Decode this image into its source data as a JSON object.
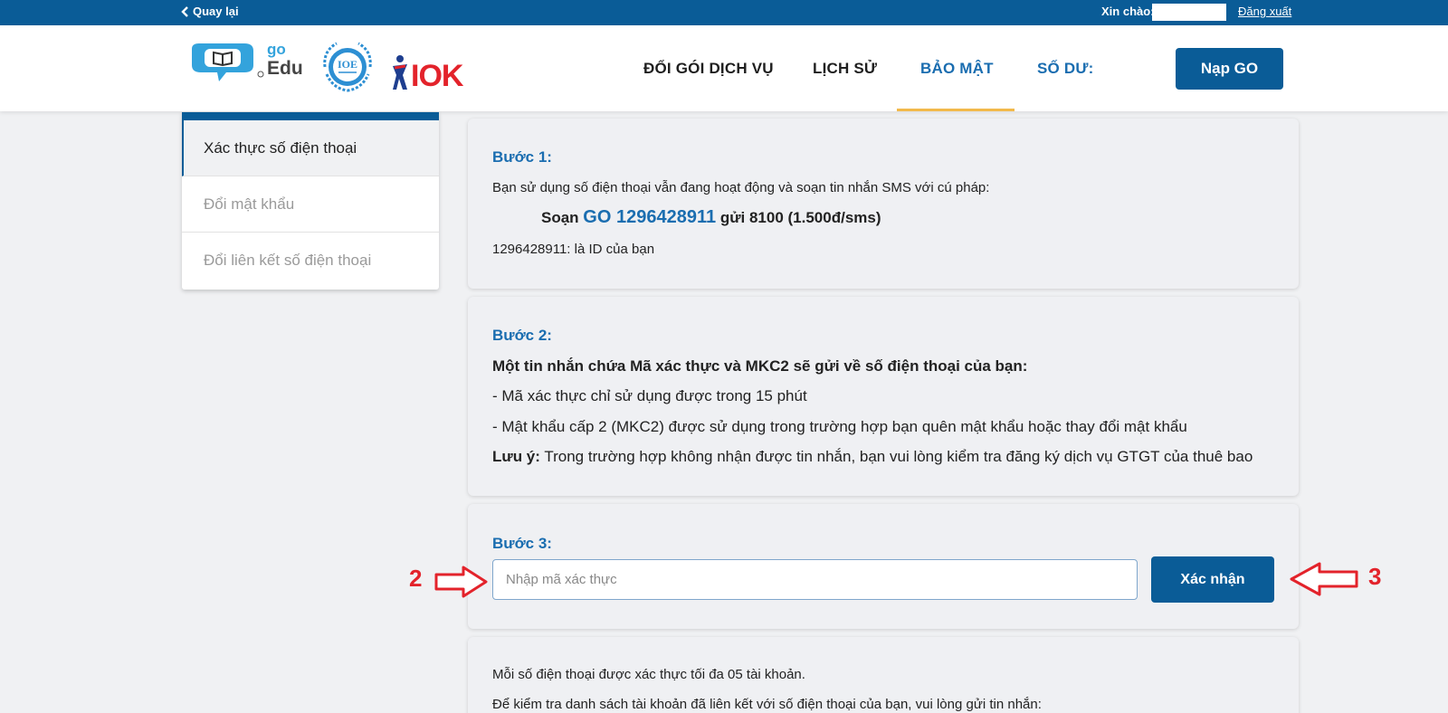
{
  "topbar": {
    "back_label": "Quay lại",
    "greeting_label": "Xin chào:",
    "username_value": "",
    "logout_label": "Đăng xuất"
  },
  "header": {
    "logos": {
      "goedu_top": "go",
      "goedu_bottom": "Edu",
      "ioe": "IOE",
      "iok": "IOK"
    },
    "nav": [
      {
        "label": "ĐỔI GÓI DỊCH VỤ",
        "active": false
      },
      {
        "label": "LỊCH SỬ",
        "active": false
      },
      {
        "label": "BẢO MẬT",
        "active": true
      },
      {
        "label": "SỐ DƯ:",
        "active": false
      }
    ],
    "topup_button": "Nạp GO"
  },
  "sidebar": {
    "items": [
      {
        "label": "Xác thực số điện thoại",
        "active": true
      },
      {
        "label": "Đổi mật khẩu",
        "active": false
      },
      {
        "label": "Đổi liên kết số điện thoại",
        "active": false
      }
    ]
  },
  "step1": {
    "title": "Bước 1:",
    "intro": "Bạn sử dụng số điện thoại vẫn đang hoạt động và soạn tin nhắn SMS với cú pháp:",
    "sms_prefix": "Soạn",
    "sms_code": "GO 1296428911",
    "sms_suffix": "gửi 8100 (1.500đ/sms)",
    "id_note": "1296428911: là ID của bạn"
  },
  "step2": {
    "title": "Bước 2:",
    "heading": "Một tin nhắn chứa Mã xác thực và MKC2 sẽ gửi về số điện thoại của bạn:",
    "line1": "- Mã xác thực chỉ sử dụng được trong 15 phút",
    "line2": "- Mật khẩu cấp 2 (MKC2) được sử dụng trong trường hợp bạn quên mật khẩu hoặc thay đổi mật khẩu",
    "note_label": "Lưu ý:",
    "note_text": "Trong trường hợp không nhận được tin nhắn, bạn vui lòng kiểm tra đăng ký dịch vụ GTGT của thuê bao"
  },
  "step3": {
    "title": "Bước 3:",
    "input_placeholder": "Nhập mã xác thực",
    "input_value": "",
    "confirm_label": "Xác nhận"
  },
  "info": {
    "line1": "Mỗi số điện thoại được xác thực tối đa 05 tài khoản.",
    "line2": "Để kiểm tra danh sách tài khoản đã liên kết với số điện thoại của bạn, vui lòng gửi tin nhắn:"
  },
  "annotations": {
    "input_marker": "2",
    "button_marker": "3",
    "color": "#e3232b"
  },
  "colors": {
    "primary": "#0a5c97",
    "accent_underline": "#f2b94b",
    "link_blue": "#1a6db0"
  }
}
